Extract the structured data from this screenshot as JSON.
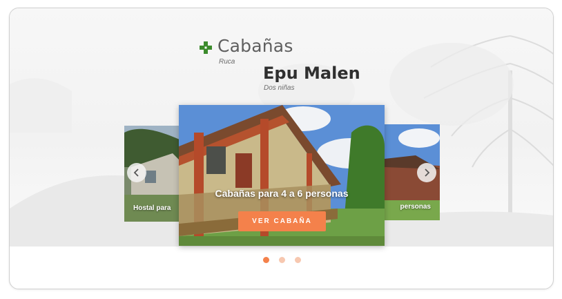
{
  "brand": {
    "title": "Cabañas",
    "subtitle1": "Ruca",
    "title2": "Epu Malen",
    "subtitle2": "Dos niñas",
    "logo_icon": "green-cross-icon",
    "logo_color": "#3c8b2c"
  },
  "carousel": {
    "slides": [
      {
        "caption": "Hostal para"
      },
      {
        "caption": "Cabañas para 4 a 6 personas",
        "button_label": "VER CABAÑA"
      },
      {
        "caption": "personas"
      }
    ],
    "prev_icon": "chevron-left-icon",
    "next_icon": "chevron-right-icon",
    "active_index": 1,
    "dot_count": 3
  },
  "colors": {
    "accent": "#f4814b",
    "accent_light": "#f7c8b0"
  }
}
